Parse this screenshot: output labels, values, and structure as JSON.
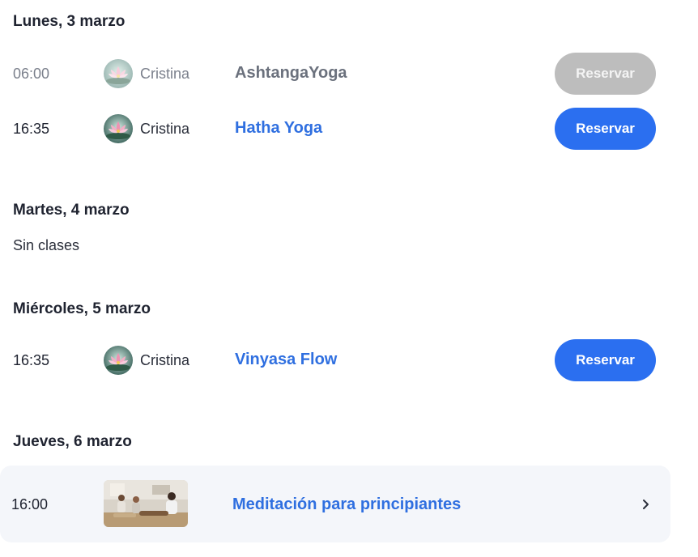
{
  "days": [
    {
      "heading": "Lunes, 3 marzo",
      "classes": [
        {
          "time": "06:00",
          "instructor": "Cristina",
          "name": "AshtangaYoga",
          "button": "Reservar",
          "available": false
        },
        {
          "time": "16:35",
          "instructor": "Cristina",
          "name": "Hatha Yoga",
          "button": "Reservar",
          "available": true
        }
      ]
    },
    {
      "heading": "Martes, 4 marzo",
      "empty_text": "Sin clases"
    },
    {
      "heading": "Miércoles, 5 marzo",
      "classes": [
        {
          "time": "16:35",
          "instructor": "Cristina",
          "name": "Vinyasa Flow",
          "button": "Reservar",
          "available": true
        }
      ]
    },
    {
      "heading": "Jueves, 6 marzo",
      "featured": {
        "time": "16:00",
        "name": "Meditación para principiantes"
      }
    }
  ],
  "icons": {
    "avatar": "lotus-flower-avatar",
    "thumbnail": "meditation-class-photo",
    "chevron": "chevron-right-icon"
  },
  "colors": {
    "accent": "#2b6ff0",
    "link": "#2f6fe0",
    "disabled_button": "#bdbdbd",
    "card_background": "#f4f6fa"
  }
}
